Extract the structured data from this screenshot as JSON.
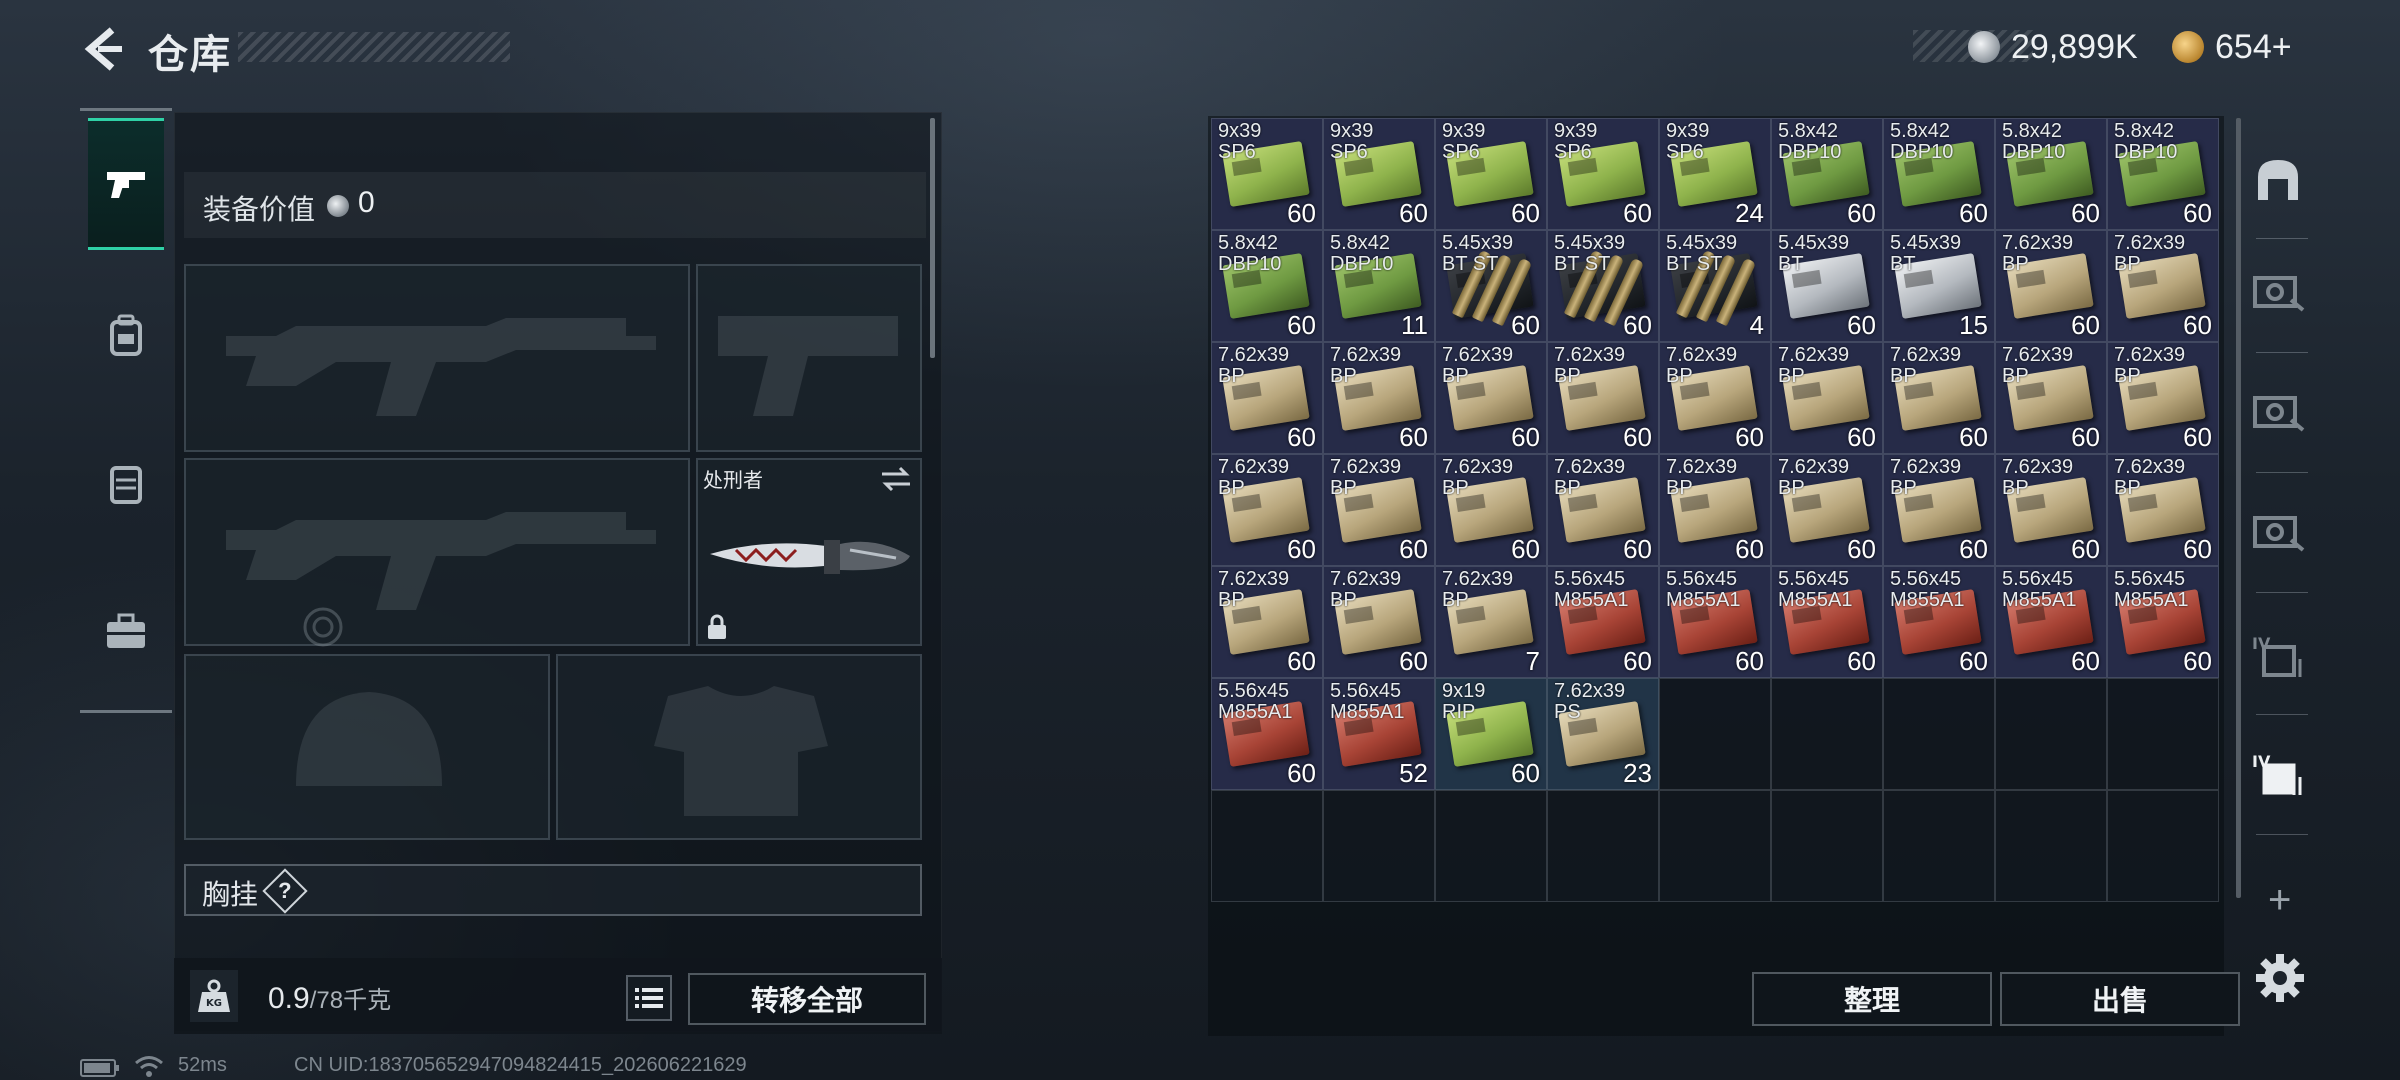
{
  "header": {
    "title": "仓库"
  },
  "currency": {
    "silver": "29,899K",
    "gold": "654+"
  },
  "equipment": {
    "value_label": "装备价值",
    "value": "0"
  },
  "knife_slot": {
    "label": "处刑者"
  },
  "chest": {
    "label": "胸挂",
    "help": "?"
  },
  "weight": {
    "current": "0.9",
    "max": "/78千克",
    "icon_text": "KG"
  },
  "buttons": {
    "transfer_all": "转移全部",
    "sort": "整理",
    "sell": "出售"
  },
  "status": {
    "ping": "52ms",
    "uid": "CN UID:1837056529470948244​15_202606221629"
  },
  "inventory": [
    {
      "cal": [
        "9x39",
        "SP6"
      ],
      "qty": "60",
      "box": "g"
    },
    {
      "cal": [
        "9x39",
        "SP6"
      ],
      "qty": "60",
      "box": "g"
    },
    {
      "cal": [
        "9x39",
        "SP6"
      ],
      "qty": "60",
      "box": "g"
    },
    {
      "cal": [
        "9x39",
        "SP6"
      ],
      "qty": "60",
      "box": "g"
    },
    {
      "cal": [
        "9x39",
        "SP6"
      ],
      "qty": "24",
      "box": "g"
    },
    {
      "cal": [
        "5.8x42",
        "DBP10"
      ],
      "qty": "60",
      "box": "dg"
    },
    {
      "cal": [
        "5.8x42",
        "DBP10"
      ],
      "qty": "60",
      "box": "dg"
    },
    {
      "cal": [
        "5.8x42",
        "DBP10"
      ],
      "qty": "60",
      "box": "dg"
    },
    {
      "cal": [
        "5.8x42",
        "DBP10"
      ],
      "qty": "60",
      "box": "dg"
    },
    {
      "cal": [
        "5.8x42",
        "DBP10"
      ],
      "qty": "60",
      "box": "dg"
    },
    {
      "cal": [
        "5.8x42",
        "DBP10"
      ],
      "qty": "11",
      "box": "dg"
    },
    {
      "cal": [
        "5.45x39",
        "BT ST"
      ],
      "qty": "60",
      "box": "dk",
      "shell": true
    },
    {
      "cal": [
        "5.45x39",
        "BT ST"
      ],
      "qty": "60",
      "box": "dk",
      "shell": true
    },
    {
      "cal": [
        "5.45x39",
        "BT ST"
      ],
      "qty": "4",
      "box": "dk",
      "shell": true
    },
    {
      "cal": [
        "5.45x39",
        "BT"
      ],
      "qty": "60",
      "box": "w"
    },
    {
      "cal": [
        "5.45x39",
        "BT"
      ],
      "qty": "15",
      "box": "w"
    },
    {
      "cal": [
        "7.62x39",
        "BP"
      ],
      "qty": "60",
      "box": "t"
    },
    {
      "cal": [
        "7.62x39",
        "BP"
      ],
      "qty": "60",
      "box": "t"
    },
    {
      "cal": [
        "7.62x39",
        "BP"
      ],
      "qty": "60",
      "box": "t"
    },
    {
      "cal": [
        "7.62x39",
        "BP"
      ],
      "qty": "60",
      "box": "t"
    },
    {
      "cal": [
        "7.62x39",
        "BP"
      ],
      "qty": "60",
      "box": "t"
    },
    {
      "cal": [
        "7.62x39",
        "BP"
      ],
      "qty": "60",
      "box": "t"
    },
    {
      "cal": [
        "7.62x39",
        "BP"
      ],
      "qty": "60",
      "box": "t"
    },
    {
      "cal": [
        "7.62x39",
        "BP"
      ],
      "qty": "60",
      "box": "t"
    },
    {
      "cal": [
        "7.62x39",
        "BP"
      ],
      "qty": "60",
      "box": "t"
    },
    {
      "cal": [
        "7.62x39",
        "BP"
      ],
      "qty": "60",
      "box": "t"
    },
    {
      "cal": [
        "7.62x39",
        "BP"
      ],
      "qty": "60",
      "box": "t"
    },
    {
      "cal": [
        "7.62x39",
        "BP"
      ],
      "qty": "60",
      "box": "t"
    },
    {
      "cal": [
        "7.62x39",
        "BP"
      ],
      "qty": "60",
      "box": "t"
    },
    {
      "cal": [
        "7.62x39",
        "BP"
      ],
      "qty": "60",
      "box": "t"
    },
    {
      "cal": [
        "7.62x39",
        "BP"
      ],
      "qty": "60",
      "box": "t"
    },
    {
      "cal": [
        "7.62x39",
        "BP"
      ],
      "qty": "60",
      "box": "t"
    },
    {
      "cal": [
        "7.62x39",
        "BP"
      ],
      "qty": "60",
      "box": "t"
    },
    {
      "cal": [
        "7.62x39",
        "BP"
      ],
      "qty": "60",
      "box": "t"
    },
    {
      "cal": [
        "7.62x39",
        "BP"
      ],
      "qty": "60",
      "box": "t"
    },
    {
      "cal": [
        "7.62x39",
        "BP"
      ],
      "qty": "60",
      "box": "t"
    },
    {
      "cal": [
        "7.62x39",
        "BP"
      ],
      "qty": "60",
      "box": "t"
    },
    {
      "cal": [
        "7.62x39",
        "BP"
      ],
      "qty": "60",
      "box": "t"
    },
    {
      "cal": [
        "7.62x39",
        "BP"
      ],
      "qty": "7",
      "box": "t"
    },
    {
      "cal": [
        "5.56x45",
        "M855A1"
      ],
      "qty": "60",
      "box": "r"
    },
    {
      "cal": [
        "5.56x45",
        "M855A1"
      ],
      "qty": "60",
      "box": "r"
    },
    {
      "cal": [
        "5.56x45",
        "M855A1"
      ],
      "qty": "60",
      "box": "r"
    },
    {
      "cal": [
        "5.56x45",
        "M855A1"
      ],
      "qty": "60",
      "box": "r"
    },
    {
      "cal": [
        "5.56x45",
        "M855A1"
      ],
      "qty": "60",
      "box": "r"
    },
    {
      "cal": [
        "5.56x45",
        "M855A1"
      ],
      "qty": "60",
      "box": "r"
    },
    {
      "cal": [
        "5.56x45",
        "M855A1"
      ],
      "qty": "60",
      "box": "r"
    },
    {
      "cal": [
        "5.56x45",
        "M855A1"
      ],
      "qty": "52",
      "box": "r"
    },
    {
      "cal": [
        "9x19",
        "RIP"
      ],
      "qty": "60",
      "box": "g",
      "hl": true
    },
    {
      "cal": [
        "7.62x39",
        "PS"
      ],
      "qty": "23",
      "box": "t",
      "hl": true
    }
  ]
}
